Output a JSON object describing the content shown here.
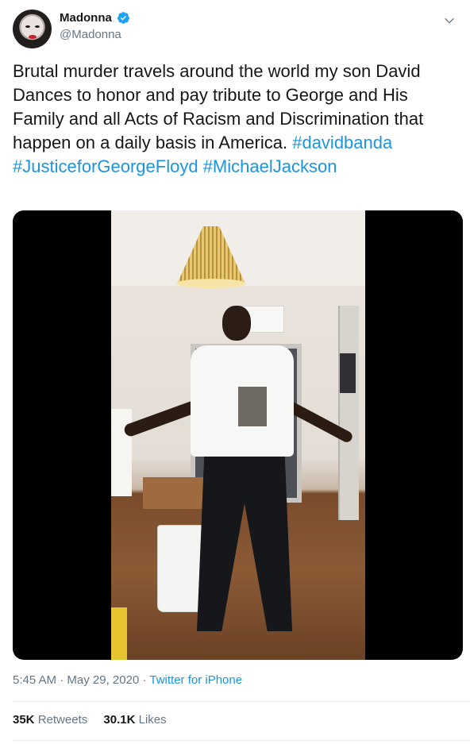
{
  "author": {
    "display_name": "Madonna",
    "handle": "@Madonna",
    "verified": true
  },
  "tweet": {
    "text_plain": "Brutal murder travels around the world my son David Dances to honor and pay tribute to George and His Family and all Acts of Racism and Discrimination that happen on a daily basis in America. ",
    "hashtags": [
      "#davidbanda",
      "#JusticeforGeorgeFloyd",
      "#MichaelJackson"
    ]
  },
  "meta": {
    "time": "5:45 AM",
    "separator": " · ",
    "date": "May 29, 2020",
    "source": "Twitter for iPhone"
  },
  "stats": {
    "retweets_count": "35K",
    "retweets_label": "Retweets",
    "likes_count": "30.1K",
    "likes_label": "Likes"
  },
  "colors": {
    "link": "#1b95e0",
    "secondary_text": "#657786",
    "primary_text": "#14171a",
    "verified_badge": "#1da1f2"
  },
  "icons": {
    "verified": "verified-badge-icon",
    "menu": "chevron-down-icon"
  }
}
